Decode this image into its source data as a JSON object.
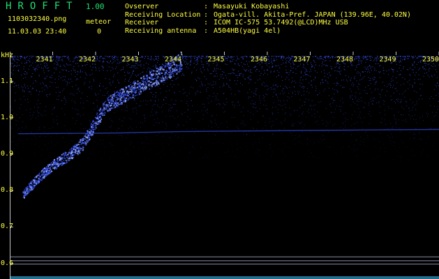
{
  "header": {
    "app_title": "HROFFT",
    "app_version": "1.00",
    "filename": "1103032340.png",
    "datetime": "11.03.03 23:40",
    "meteor_label": "meteor",
    "meteor_count": "0",
    "info": [
      {
        "key": "Ovserver",
        "value": "Masayuki Kobayashi"
      },
      {
        "key": "Receiving Location",
        "value": "Ogata-vill. Akita-Pref. JAPAN (139.96E, 40.02N)"
      },
      {
        "key": "Receiver",
        "value": "ICOM IC-575 53.7492(@LCD)MHz USB"
      },
      {
        "key": "Receiving antenna",
        "value": "A504HB(yagi 4el)"
      }
    ]
  },
  "colors": {
    "background": "#000000",
    "header_text": "#ffff40",
    "title_text": "#20e070",
    "signal": "#3a55ff",
    "signal_bright": "#9ab0ff",
    "reference_line": "#8890a8",
    "bottom_band": "#40c8ff"
  },
  "chart_data": {
    "type": "heatmap",
    "title": "",
    "y_unit": "kHz",
    "y_ticks": [
      "1.1",
      "1.0",
      "0.9",
      "0.8",
      "0.7",
      "0.6"
    ],
    "x_ticks": [
      "2341",
      "2342",
      "2343",
      "2344",
      "2345",
      "2346",
      "2347",
      "2348",
      "2349",
      "2350"
    ],
    "x_range": [
      "2340",
      "2350"
    ],
    "y_range": [
      0.58,
      1.17
    ],
    "traces": [
      {
        "name": "",
        "description": "drifting bright trace",
        "points": [
          [
            2340.3,
            0.79
          ],
          [
            2340.7,
            0.84
          ],
          [
            2341.0,
            0.87
          ],
          [
            2341.4,
            0.9
          ],
          [
            2341.7,
            0.93
          ],
          [
            2341.9,
            0.97
          ],
          [
            2342.1,
            1.01
          ],
          [
            2342.3,
            1.04
          ],
          [
            2342.6,
            1.06
          ],
          [
            2342.9,
            1.08
          ],
          [
            2343.2,
            1.1
          ],
          [
            2343.5,
            1.12
          ],
          [
            2343.8,
            1.14
          ],
          [
            2344.0,
            1.16
          ]
        ]
      },
      {
        "name": "",
        "description": "faint steady carrier",
        "points": [
          [
            2340.2,
            0.956
          ],
          [
            2341.5,
            0.957
          ],
          [
            2342.5,
            0.958
          ],
          [
            2344.0,
            0.962
          ],
          [
            2346.0,
            0.964
          ],
          [
            2348.0,
            0.966
          ],
          [
            2350.0,
            0.968
          ]
        ]
      }
    ],
    "noise_band_top_kHz": 1.17,
    "reference_lines_kHz": [
      0.618,
      0.607,
      0.598
    ]
  }
}
